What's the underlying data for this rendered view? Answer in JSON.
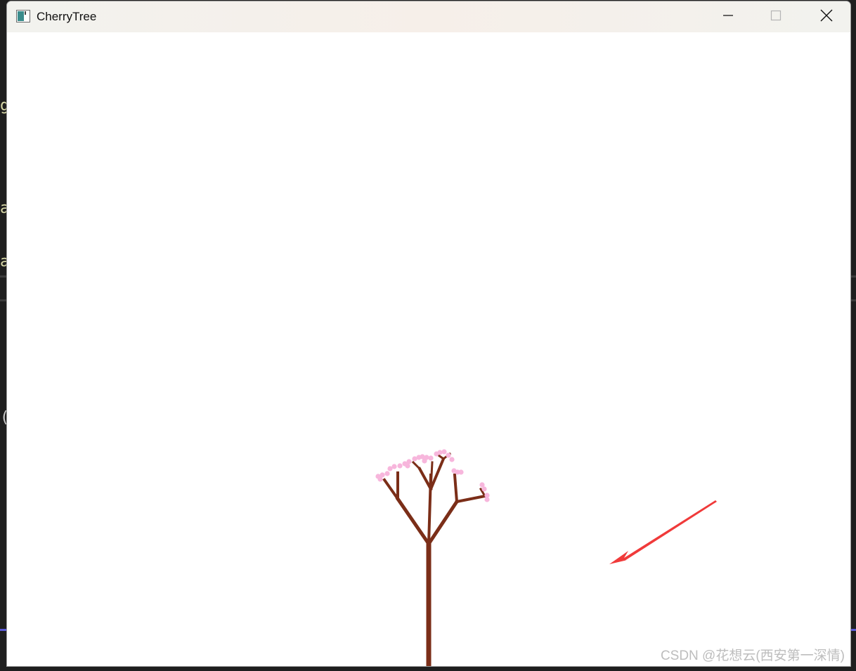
{
  "window": {
    "title": "CherryTree",
    "icon": "app-window-icon",
    "controls": {
      "minimize_icon": "minimize-icon",
      "maximize_icon": "maximize-icon",
      "close_icon": "close-icon"
    }
  },
  "canvas": {
    "background": "#ffffff",
    "trunk_color": "#7b2e18",
    "blossom_color": "#f7b6dc",
    "annotation_arrow_color": "#f03a3a"
  },
  "watermark": "CSDN @花想云(西安第一深情)",
  "background_editor": {
    "glyphs": [
      "g",
      "a",
      "a",
      "(",
      "]"
    ]
  }
}
